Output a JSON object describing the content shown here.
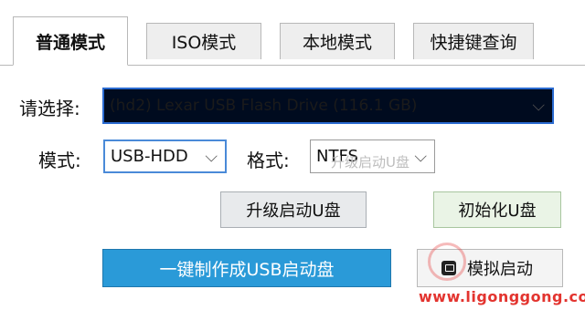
{
  "tabs": [
    "普通模式",
    "ISO模式",
    "本地模式",
    "快捷键查询"
  ],
  "form": {
    "select_label": "请选择:",
    "device_value": "(hd2) Lexar USB Flash Drive (116.1 GB)",
    "mode_label": "模式:",
    "mode_value": "USB-HDD",
    "format_label": "格式:",
    "format_value": "NTFS",
    "format_ghost": "升级启动U盘"
  },
  "buttons": {
    "upgrade": "升级启动U盘",
    "init": "初始化U盘",
    "make": "一键制作成USB启动盘",
    "simulate": "模拟启动"
  },
  "watermark": "www.ligonggong.com",
  "colors": {
    "accent_blue": "#2a9ad8",
    "device_bg": "#000b1f",
    "watermark_red": "#e3342f"
  }
}
